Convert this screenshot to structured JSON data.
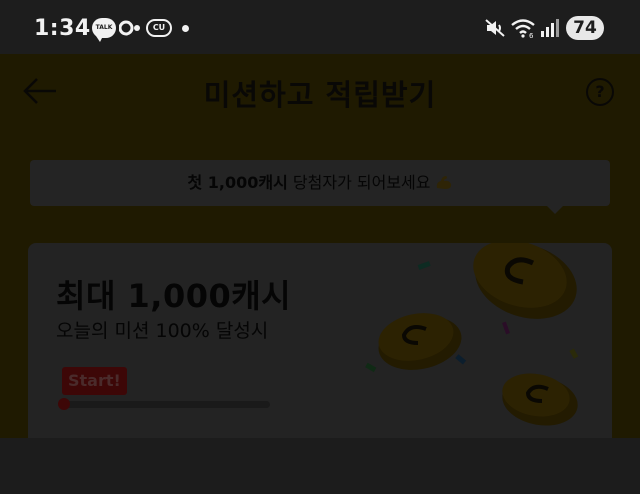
{
  "status_bar": {
    "time": "1:34",
    "talk_badge": "TALK",
    "cu_badge": "CU",
    "battery": "74"
  },
  "header": {
    "title": "미션하고 적립받기",
    "help_label": "?"
  },
  "banner": {
    "highlight": "첫 1,000캐시",
    "text": " 당첨자가 되어보세요"
  },
  "card": {
    "title": "최대 1,000캐시",
    "subtitle": "오늘의 미션 100% 달성시",
    "start_label": "Start!",
    "progress": 0
  },
  "colors": {
    "overlay_background": "#141414",
    "dimmed_yellow": "#1f1a01",
    "start_red": "#3d0707"
  }
}
